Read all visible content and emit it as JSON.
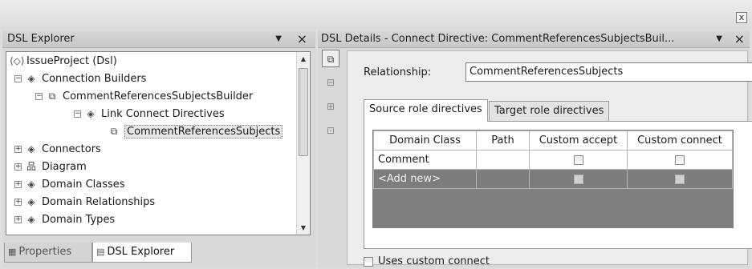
{
  "left_panel": {
    "title": "DSL Explorer",
    "tree": [
      {
        "label": "IssueProject (Dsl)",
        "icon": "dsl-root-icon"
      },
      {
        "label": "Connection Builders",
        "icon": "folder-diamond-icon"
      },
      {
        "label": "CommentReferencesSubjectsBuilder",
        "icon": "connection-builder-icon"
      },
      {
        "label": "Link Connect Directives",
        "icon": "folder-diamond-icon"
      },
      {
        "label": "CommentReferencesSubjects",
        "icon": "connection-builder-icon"
      },
      {
        "label": "Connectors",
        "icon": "folder-diamond-icon"
      },
      {
        "label": "Diagram",
        "icon": "diagram-icon"
      },
      {
        "label": "Domain Classes",
        "icon": "folder-diamond-icon"
      },
      {
        "label": "Domain Relationships",
        "icon": "folder-diamond-icon"
      },
      {
        "label": "Domain Types",
        "icon": "folder-diamond-icon"
      }
    ],
    "bottom_tabs": [
      "Properties",
      "DSL Explorer"
    ]
  },
  "right_panel": {
    "title": "DSL Details - Connect Directive: CommentReferencesSubjectsBuil...",
    "relationship_label": "Relationship:",
    "relationship_value": "CommentReferencesSubjects",
    "tabs": [
      "Source role directives",
      "Target role directives"
    ],
    "grid": {
      "columns": [
        "Domain Class",
        "Path",
        "Custom accept",
        "Custom connect"
      ],
      "rows": [
        {
          "domain_class": "Comment",
          "path": "",
          "custom_accept": false,
          "custom_connect": false
        },
        {
          "domain_class": "<Add new>",
          "path": "",
          "custom_accept": false,
          "custom_connect": false
        }
      ]
    },
    "uses_custom_connect_label": "Uses custom connect",
    "uses_custom_connect": false
  }
}
